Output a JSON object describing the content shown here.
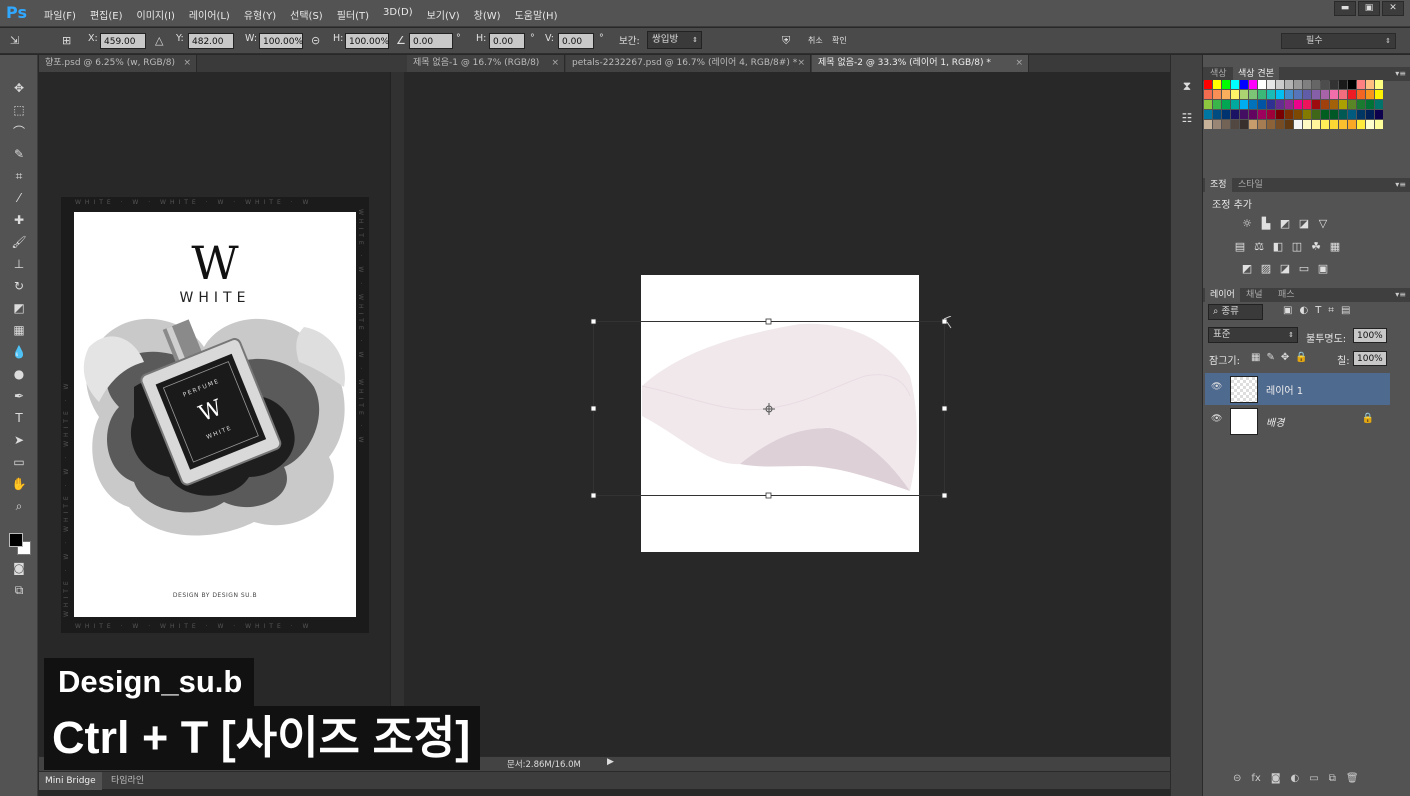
{
  "app": {
    "logo": "Ps"
  },
  "menu": [
    "파일(F)",
    "편집(E)",
    "이미지(I)",
    "레이어(L)",
    "유형(Y)",
    "선택(S)",
    "필터(T)",
    "3D(D)",
    "보기(V)",
    "창(W)",
    "도움말(H)"
  ],
  "window_controls": [
    "▬",
    "▣",
    "✕"
  ],
  "options": {
    "x_label": "X:",
    "x_value": "459.00 px",
    "y_label": "Y:",
    "y_value": "482.00 px",
    "w_label": "W:",
    "w_value": "100.00%",
    "h_label": "H:",
    "h_value": "100.00%",
    "angle_value": "0.00",
    "hskew_label": "H:",
    "hskew_value": "0.00",
    "vskew_label": "V:",
    "vskew_value": "0.00",
    "degree": "°",
    "interp_label": "보간:",
    "interp_value": "쌍입방",
    "cancel": "취소",
    "commit": "확인",
    "workspace": "필수"
  },
  "tabs": [
    {
      "label": "향포.psd @ 6.25% (w, RGB/8)",
      "close": "×"
    },
    {
      "label": "제목 없음-1 @ 16.7% (RGB/8)",
      "close": "×"
    },
    {
      "label": "petals-2232267.psd @ 16.7% (레이어 4, RGB/8#) *",
      "close": "×"
    },
    {
      "label": "제목 없음-2 @ 33.3% (레이어 1, RGB/8) *",
      "close": "×"
    }
  ],
  "poster": {
    "logo_letter": "W",
    "brand": "WHITE",
    "credit": "DESIGN BY DESIGN SU.B",
    "label_top": "PERFUME",
    "label_mid": "W",
    "label_bottom": "WHITE",
    "frame_text": "WHITE · W · WHITE · W · WHITE · W"
  },
  "status": {
    "doc_size": "문서:2.86M/16.0M",
    "arrow": "▶"
  },
  "bottom_tabs": [
    "Mini Bridge",
    "타임라인"
  ],
  "panels": {
    "color_tabs": [
      "색상",
      "색상 견본"
    ],
    "adjust_tabs": [
      "조정",
      "스타일"
    ],
    "adjust_title": "조정 추가",
    "layer_tabs": [
      "레이어",
      "채널",
      "패스"
    ],
    "filter_kind": "종류",
    "blend_mode": "표준",
    "opacity_label": "불투명도:",
    "opacity_value": "100%",
    "lock_label": "잠그기:",
    "fill_label": "칠:",
    "fill_value": "100%",
    "layers": [
      {
        "name": "레이어 1",
        "selected": true
      },
      {
        "name": "배경",
        "selected": false,
        "locked": true
      }
    ],
    "swatch_colors": [
      "#ff0000",
      "#ffff00",
      "#00ff00",
      "#00ffff",
      "#0000ff",
      "#ff00ff",
      "#ffffff",
      "#e6e6e6",
      "#cccccc",
      "#b3b3b3",
      "#999999",
      "#808080",
      "#666666",
      "#4d4d4d",
      "#333333",
      "#1a1a1a",
      "#000000",
      "#ff8080",
      "#ffbf80",
      "#ffff80",
      "#f26c4f",
      "#f68e55",
      "#fbaf5c",
      "#fff467",
      "#acd372",
      "#7cc576",
      "#3bb878",
      "#1abbb4",
      "#00bff3",
      "#438ccb",
      "#5574b9",
      "#605ca8",
      "#855fa8",
      "#a763a8",
      "#f06ea9",
      "#f26d7d",
      "#ed1c24",
      "#f26522",
      "#f7941d",
      "#fff200",
      "#8dc63f",
      "#39b54a",
      "#00a651",
      "#00a99d",
      "#00aeef",
      "#0072bc",
      "#0054a6",
      "#2e3192",
      "#662d91",
      "#92278f",
      "#ec008c",
      "#ed145b",
      "#9e0b0f",
      "#a0410d",
      "#a36209",
      "#aba000",
      "#598527",
      "#1a7b30",
      "#007236",
      "#00746b",
      "#0076a3",
      "#004b80",
      "#003471",
      "#1b1464",
      "#440e62",
      "#630460",
      "#9e005d",
      "#9e0039",
      "#790000",
      "#7b2e00",
      "#7d4900",
      "#827b00",
      "#406618",
      "#005e20",
      "#005826",
      "#005952",
      "#005b7f",
      "#003663",
      "#002157",
      "#0d004c",
      "#c7b299",
      "#998675",
      "#736357",
      "#534741",
      "#37302d",
      "#c69c6d",
      "#a67c52",
      "#8c6239",
      "#754c24",
      "#603913",
      "#f5f5f5",
      "#fff9c4",
      "#fff59d",
      "#ffee58",
      "#fdd835",
      "#fbc02d",
      "#f9a825",
      "#ffeb3b",
      "#ffffcc",
      "#ffff99"
    ]
  }
}
